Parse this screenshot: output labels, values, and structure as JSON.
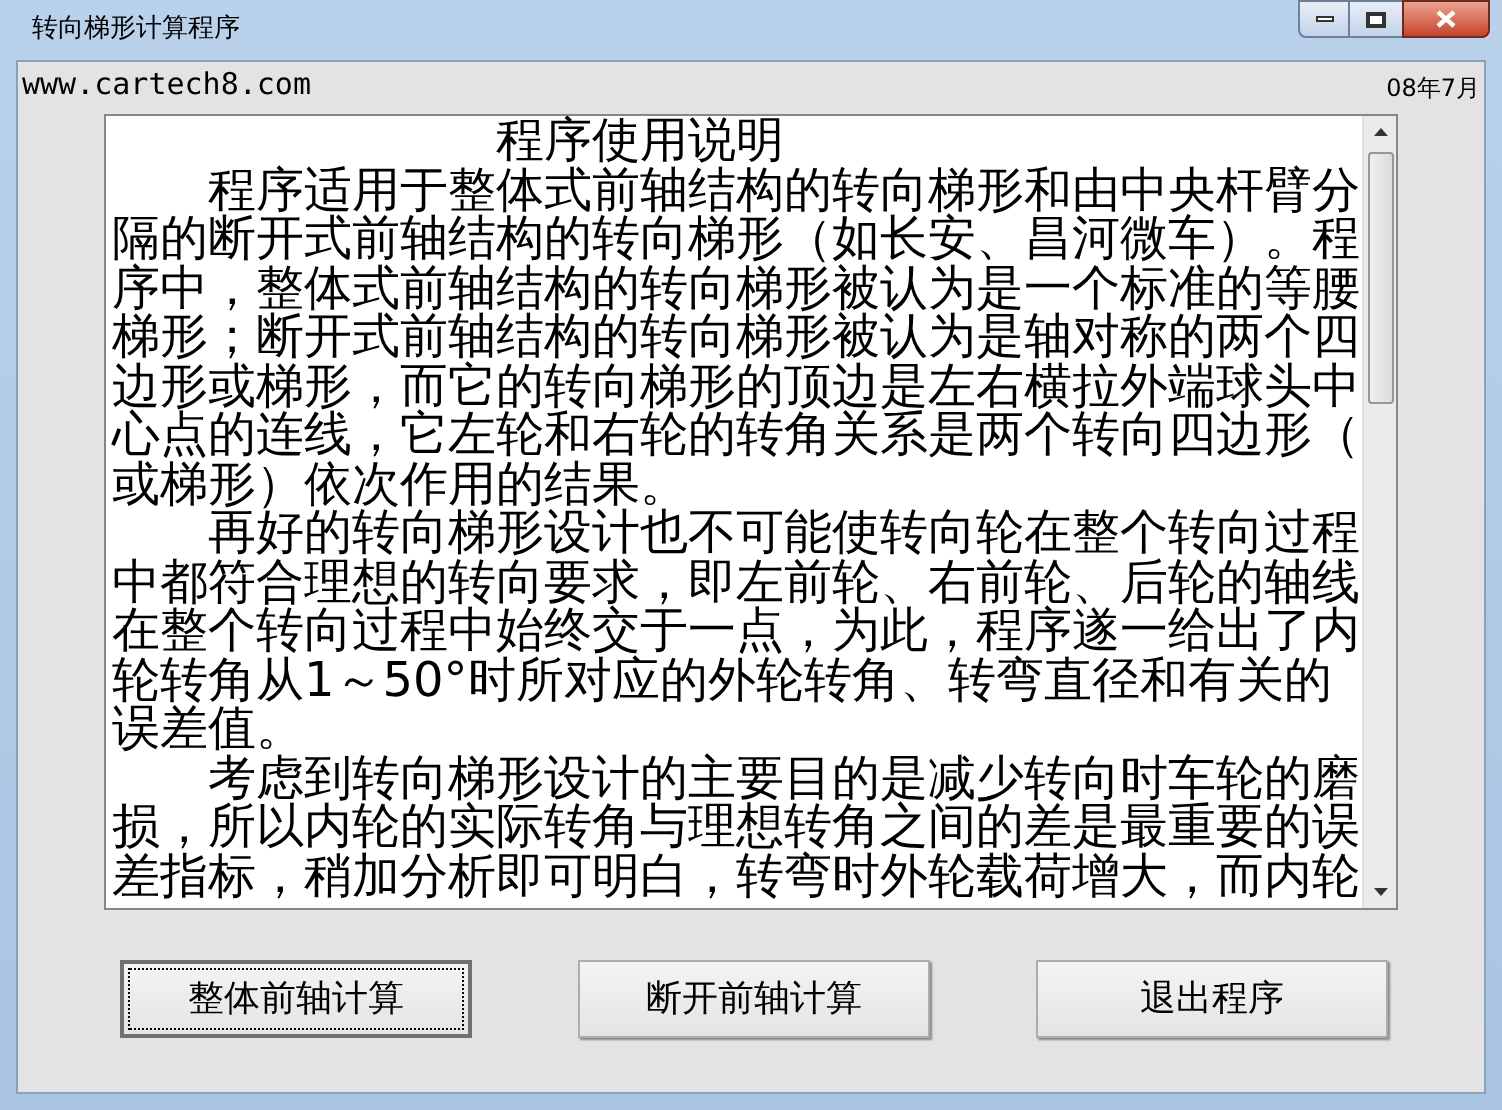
{
  "window": {
    "title": "转向梯形计算程序"
  },
  "header": {
    "website": "www.cartech8.com",
    "date": "08年7月"
  },
  "document": {
    "title": "程序使用说明",
    "paragraphs": [
      "程序适用于整体式前轴结构的转向梯形和由中央杆臂分隔的断开式前轴结构的转向梯形（如长安、昌河微车）。程序中，整体式前轴结构的转向梯形被认为是一个标准的等腰梯形；断开式前轴结构的转向梯形被认为是轴对称的两个四边形或梯形，而它的转向梯形的顶边是左右横拉外端球头中心点的连线，它左轮和右轮的转角关系是两个转向四边形（或梯形）依次作用的结果。",
      "再好的转向梯形设计也不可能使转向轮在整个转向过程中都符合理想的转向要求，即左前轮、右前轮、后轮的轴线在整个转向过程中始终交于一点，为此，程序遂一给出了内轮转角从1～50°时所对应的外轮转角、转弯直径和有关的误差值。",
      "考虑到转向梯形设计的主要目的是减少转向时车轮的磨损，所以内轮的实际转角与理想转角之间的差是最重要的误差指标，稍加分析即可明白，转弯时外轮载荷增大，而内轮"
    ]
  },
  "buttons": [
    {
      "label": "整体前轴计算",
      "focused": true
    },
    {
      "label": "断开前轴计算",
      "focused": false
    },
    {
      "label": "退出程序",
      "focused": false
    }
  ]
}
